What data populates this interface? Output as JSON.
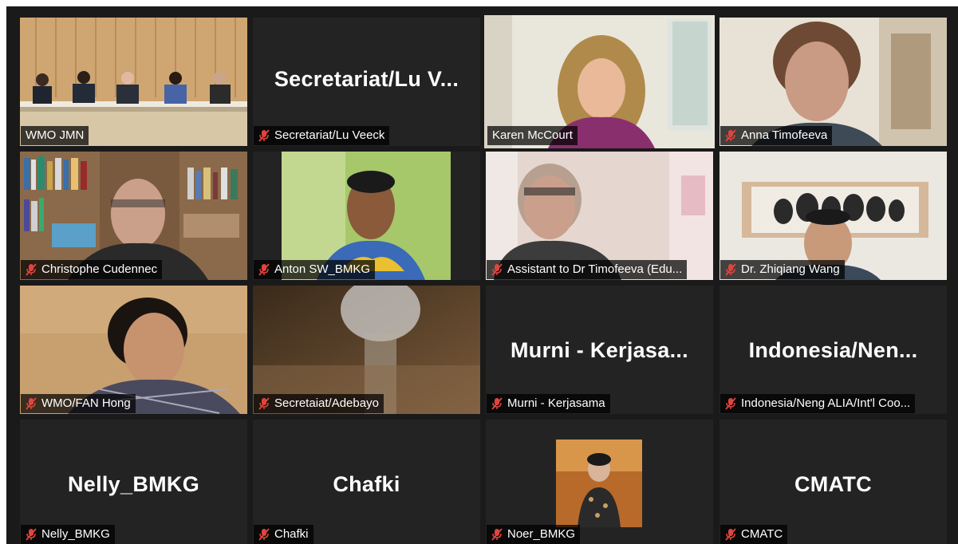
{
  "tiles": [
    {
      "label": "WMO JMN",
      "muted": false,
      "active": false
    },
    {
      "label": "Secretariat/Lu Veeck",
      "muted": true,
      "big_name": "Secretariat/Lu  V..."
    },
    {
      "label": "Karen McCourt",
      "muted": false,
      "active": true
    },
    {
      "label": "Anna Timofeeva",
      "muted": true
    },
    {
      "label": "Christophe Cudennec",
      "muted": true
    },
    {
      "label": "Anton SW_BMKG",
      "muted": true
    },
    {
      "label": "Assistant to Dr Timofeeva (Edu...",
      "muted": true
    },
    {
      "label": "Dr. Zhiqiang Wang",
      "muted": true
    },
    {
      "label": "WMO/FAN Hong",
      "muted": true
    },
    {
      "label": "Secretaiat/Adebayo",
      "muted": true
    },
    {
      "label": "Murni - Kerjasama",
      "muted": true,
      "big_name": "Murni  -  Kerjasa..."
    },
    {
      "label": "Indonesia/Neng ALIA/Int'l Coo...",
      "muted": true,
      "big_name": "Indonesia/Nen..."
    },
    {
      "label": "Nelly_BMKG",
      "muted": true,
      "big_name": "Nelly_BMKG"
    },
    {
      "label": "Chafki",
      "muted": true,
      "big_name": "Chafki"
    },
    {
      "label": "Noer_BMKG",
      "muted": true
    },
    {
      "label": "CMATC",
      "muted": true,
      "big_name": "CMATC"
    }
  ],
  "colors": {
    "active_speaker_border": "#c9e265",
    "mute_icon": "#e0443e",
    "background": "#1a1a1a"
  }
}
